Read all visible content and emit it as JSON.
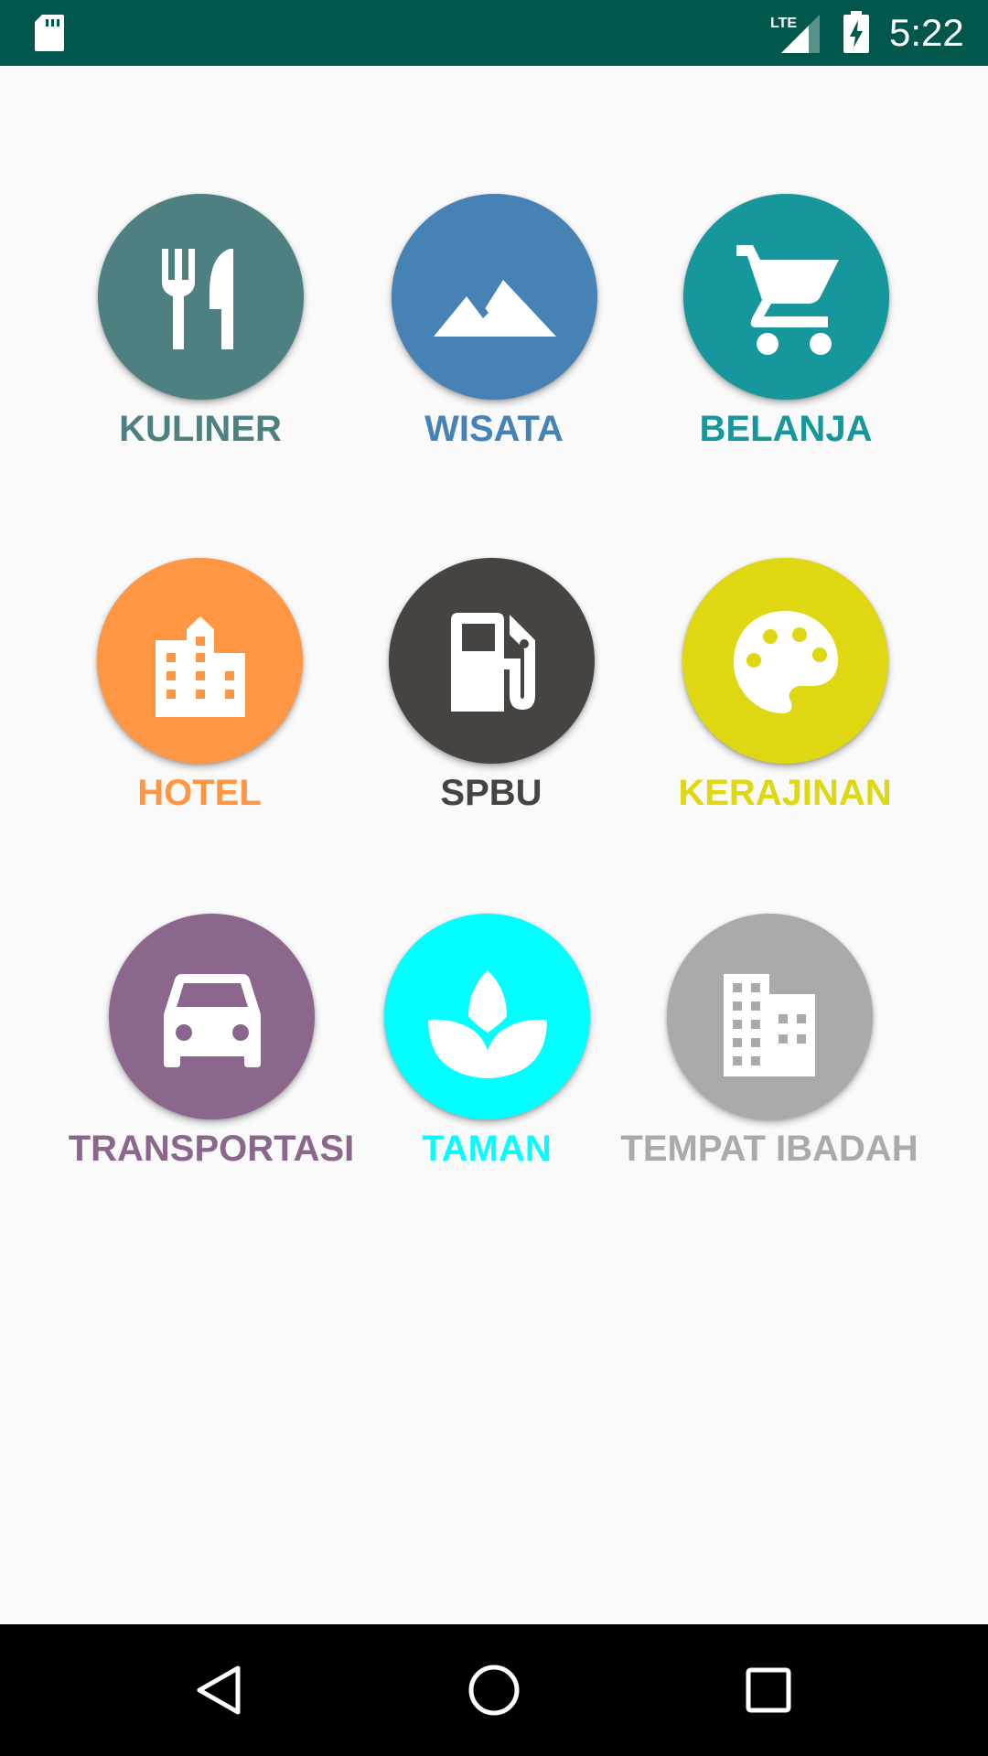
{
  "status_bar": {
    "time": "5:22",
    "network": "LTE",
    "background_color": "#01574B",
    "icons": [
      "sd-card-icon",
      "lte-signal-icon",
      "battery-charging-icon"
    ]
  },
  "categories": [
    {
      "label": "KULINER",
      "color": "#4F8081",
      "icon": "restaurant-icon"
    },
    {
      "label": "WISATA",
      "color": "#4682B4",
      "icon": "landscape-icon"
    },
    {
      "label": "BELANJA",
      "color": "#16979B",
      "icon": "shopping-cart-icon"
    },
    {
      "label": "HOTEL",
      "color": "#FF9644",
      "icon": "hotel-building-icon"
    },
    {
      "label": "SPBU",
      "color": "#464341",
      "icon": "gas-station-icon"
    },
    {
      "label": "KERAJINAN",
      "color": "#DED712",
      "icon": "palette-icon"
    },
    {
      "label": "TRANSPORTASI",
      "color": "#8B668D",
      "icon": "car-icon"
    },
    {
      "label": "TAMAN",
      "color": "#00FFFF",
      "icon": "spa-icon"
    },
    {
      "label": "TEMPAT IBADAH",
      "color": "#AAAAAA",
      "icon": "building-icon"
    }
  ],
  "nav_bar": {
    "buttons": [
      "back-icon",
      "home-icon",
      "recents-icon"
    ]
  }
}
